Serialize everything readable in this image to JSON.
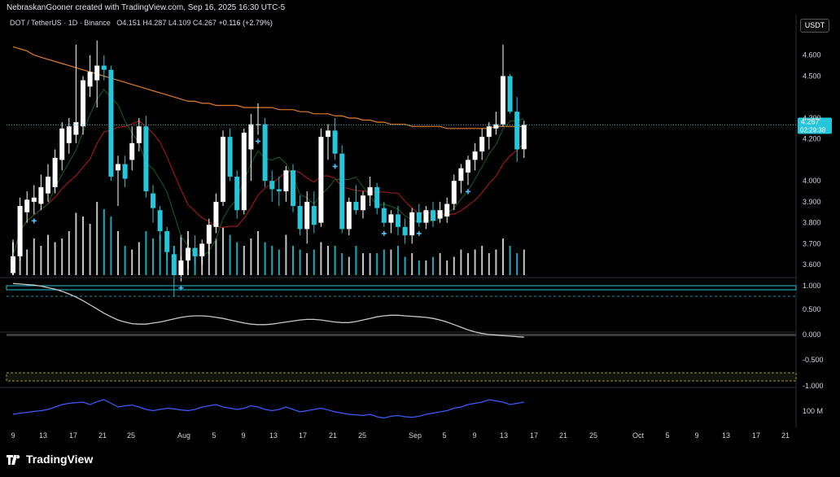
{
  "header": {
    "created_text": "NebraskanGooner created with TradingView.com, Sep 16, 2025 16:30 UTC-5",
    "symbol": "DOT / TetherUS · 1D · Binance",
    "open_label": "O",
    "open": "4.151",
    "high_label": "H",
    "high": "4.287",
    "low_label": "L",
    "low": "4.109",
    "close_label": "C",
    "close": "4.267",
    "change": "+0.116 (+2.79%)"
  },
  "currency_button": "USDT",
  "footer": {
    "brand": "TradingView"
  },
  "colors": {
    "up": "#ffffff",
    "down": "#26c6da",
    "ma_long": "#e07b2c",
    "ma_mid": "#b71c1c",
    "ma_short": "#1b5e20",
    "teal_lines": "#26c6da",
    "yellow": "#c6c43a",
    "osc": "#c8c8c8",
    "rsi": "#3d5afe",
    "price_tag": "#26c6da"
  },
  "chart_data": {
    "type": "candlestick",
    "ohlc": [
      {
        "o": 3.56,
        "h": 3.72,
        "l": 3.55,
        "c": 3.64
      },
      {
        "o": 3.64,
        "h": 3.92,
        "l": 3.62,
        "c": 3.88
      },
      {
        "o": 3.85,
        "h": 3.95,
        "l": 3.8,
        "c": 3.91
      },
      {
        "o": 3.9,
        "h": 3.98,
        "l": 3.84,
        "c": 3.92
      },
      {
        "o": 3.89,
        "h": 4.03,
        "l": 3.86,
        "c": 3.97
      },
      {
        "o": 3.94,
        "h": 4.08,
        "l": 3.9,
        "c": 4.02
      },
      {
        "o": 3.97,
        "h": 4.15,
        "l": 3.94,
        "c": 4.11
      },
      {
        "o": 4.1,
        "h": 4.28,
        "l": 4.05,
        "c": 4.25
      },
      {
        "o": 4.18,
        "h": 4.3,
        "l": 4.13,
        "c": 4.26
      },
      {
        "o": 4.22,
        "h": 4.65,
        "l": 4.18,
        "c": 4.28
      },
      {
        "o": 4.26,
        "h": 4.5,
        "l": 4.22,
        "c": 4.48
      },
      {
        "o": 4.45,
        "h": 4.6,
        "l": 4.4,
        "c": 4.52
      },
      {
        "o": 4.48,
        "h": 4.67,
        "l": 4.35,
        "c": 4.55
      },
      {
        "o": 4.55,
        "h": 4.6,
        "l": 4.48,
        "c": 4.53
      },
      {
        "o": 4.53,
        "h": 4.55,
        "l": 4.0,
        "c": 4.02
      },
      {
        "o": 4.05,
        "h": 4.12,
        "l": 3.88,
        "c": 4.08
      },
      {
        "o": 4.08,
        "h": 4.12,
        "l": 3.97,
        "c": 4.01
      },
      {
        "o": 4.1,
        "h": 4.26,
        "l": 4.05,
        "c": 4.18
      },
      {
        "o": 4.18,
        "h": 4.3,
        "l": 4.14,
        "c": 4.26
      },
      {
        "o": 4.26,
        "h": 4.31,
        "l": 3.92,
        "c": 3.95
      },
      {
        "o": 3.94,
        "h": 3.98,
        "l": 3.8,
        "c": 3.87
      },
      {
        "o": 3.86,
        "h": 3.88,
        "l": 3.72,
        "c": 3.76
      },
      {
        "o": 3.76,
        "h": 3.78,
        "l": 3.62,
        "c": 3.66
      },
      {
        "o": 3.65,
        "h": 3.69,
        "l": 3.45,
        "c": 3.55
      },
      {
        "o": 3.55,
        "h": 3.64,
        "l": 3.52,
        "c": 3.62
      },
      {
        "o": 3.62,
        "h": 3.72,
        "l": 3.58,
        "c": 3.68
      },
      {
        "o": 3.68,
        "h": 3.74,
        "l": 3.6,
        "c": 3.64
      },
      {
        "o": 3.64,
        "h": 3.72,
        "l": 3.6,
        "c": 3.7
      },
      {
        "o": 3.7,
        "h": 3.82,
        "l": 3.65,
        "c": 3.79
      },
      {
        "o": 3.78,
        "h": 3.94,
        "l": 3.75,
        "c": 3.9
      },
      {
        "o": 3.9,
        "h": 4.24,
        "l": 3.88,
        "c": 4.21
      },
      {
        "o": 4.21,
        "h": 4.25,
        "l": 4.0,
        "c": 4.02
      },
      {
        "o": 4.02,
        "h": 4.05,
        "l": 3.82,
        "c": 3.86
      },
      {
        "o": 3.86,
        "h": 4.25,
        "l": 3.84,
        "c": 4.23
      },
      {
        "o": 4.15,
        "h": 4.32,
        "l": 4.0,
        "c": 4.27
      },
      {
        "o": 4.27,
        "h": 4.37,
        "l": 4.22,
        "c": 4.27
      },
      {
        "o": 4.27,
        "h": 4.3,
        "l": 3.97,
        "c": 4.0
      },
      {
        "o": 4.0,
        "h": 4.05,
        "l": 3.9,
        "c": 3.96
      },
      {
        "o": 3.96,
        "h": 4.02,
        "l": 3.88,
        "c": 3.95
      },
      {
        "o": 3.95,
        "h": 4.07,
        "l": 3.9,
        "c": 4.05
      },
      {
        "o": 4.05,
        "h": 4.08,
        "l": 3.85,
        "c": 3.88
      },
      {
        "o": 3.88,
        "h": 3.93,
        "l": 3.74,
        "c": 3.77
      },
      {
        "o": 3.77,
        "h": 3.95,
        "l": 3.7,
        "c": 3.9
      },
      {
        "o": 3.88,
        "h": 3.95,
        "l": 3.75,
        "c": 3.79
      },
      {
        "o": 3.8,
        "h": 4.25,
        "l": 3.78,
        "c": 4.21
      },
      {
        "o": 4.21,
        "h": 4.27,
        "l": 4.1,
        "c": 4.24
      },
      {
        "o": 4.24,
        "h": 4.3,
        "l": 4.1,
        "c": 4.13
      },
      {
        "o": 4.13,
        "h": 4.17,
        "l": 3.75,
        "c": 3.77
      },
      {
        "o": 3.77,
        "h": 3.92,
        "l": 3.74,
        "c": 3.9
      },
      {
        "o": 3.9,
        "h": 3.98,
        "l": 3.84,
        "c": 3.86
      },
      {
        "o": 3.86,
        "h": 3.95,
        "l": 3.82,
        "c": 3.93
      },
      {
        "o": 3.93,
        "h": 4.02,
        "l": 3.88,
        "c": 3.97
      },
      {
        "o": 3.97,
        "h": 3.99,
        "l": 3.84,
        "c": 3.87
      },
      {
        "o": 3.87,
        "h": 3.9,
        "l": 3.78,
        "c": 3.8
      },
      {
        "o": 3.8,
        "h": 3.86,
        "l": 3.75,
        "c": 3.84
      },
      {
        "o": 3.84,
        "h": 3.88,
        "l": 3.74,
        "c": 3.78
      },
      {
        "o": 3.78,
        "h": 3.82,
        "l": 3.7,
        "c": 3.74
      },
      {
        "o": 3.74,
        "h": 3.87,
        "l": 3.7,
        "c": 3.85
      },
      {
        "o": 3.85,
        "h": 3.89,
        "l": 3.78,
        "c": 3.8
      },
      {
        "o": 3.8,
        "h": 3.88,
        "l": 3.77,
        "c": 3.86
      },
      {
        "o": 3.86,
        "h": 3.9,
        "l": 3.78,
        "c": 3.81
      },
      {
        "o": 3.82,
        "h": 3.9,
        "l": 3.8,
        "c": 3.86
      },
      {
        "o": 3.83,
        "h": 3.92,
        "l": 3.8,
        "c": 3.89
      },
      {
        "o": 3.89,
        "h": 4.03,
        "l": 3.86,
        "c": 4.0
      },
      {
        "o": 4.0,
        "h": 4.08,
        "l": 3.94,
        "c": 4.06
      },
      {
        "o": 4.04,
        "h": 4.12,
        "l": 3.98,
        "c": 4.1
      },
      {
        "o": 4.1,
        "h": 4.18,
        "l": 4.05,
        "c": 4.14
      },
      {
        "o": 4.14,
        "h": 4.25,
        "l": 4.1,
        "c": 4.21
      },
      {
        "o": 4.21,
        "h": 4.28,
        "l": 4.15,
        "c": 4.26
      },
      {
        "o": 4.25,
        "h": 4.33,
        "l": 4.22,
        "c": 4.27
      },
      {
        "o": 4.27,
        "h": 4.65,
        "l": 4.26,
        "c": 4.5
      },
      {
        "o": 4.5,
        "h": 4.51,
        "l": 4.32,
        "c": 4.33
      },
      {
        "o": 4.33,
        "h": 4.4,
        "l": 4.09,
        "c": 4.15
      },
      {
        "o": 4.151,
        "h": 4.287,
        "l": 4.109,
        "c": 4.267
      }
    ],
    "volume_relative": [
      0.45,
      0.4,
      0.35,
      0.5,
      0.4,
      0.55,
      0.45,
      0.5,
      0.6,
      0.85,
      0.8,
      0.7,
      1.0,
      0.9,
      0.8,
      0.6,
      0.4,
      0.35,
      0.45,
      0.6,
      0.5,
      0.55,
      0.45,
      0.4,
      0.55,
      0.6,
      0.35,
      0.4,
      0.45,
      0.5,
      0.65,
      0.55,
      0.45,
      0.4,
      0.5,
      0.6,
      0.45,
      0.4,
      0.35,
      0.55,
      0.4,
      0.35,
      0.3,
      0.35,
      0.45,
      0.4,
      0.4,
      0.3,
      0.25,
      0.4,
      0.3,
      0.3,
      0.3,
      0.35,
      0.35,
      0.4,
      0.25,
      0.3,
      0.2,
      0.2,
      0.25,
      0.3,
      0.2,
      0.25,
      0.35,
      0.3,
      0.35,
      0.4,
      0.3,
      0.35,
      0.5,
      0.4,
      0.3,
      0.35
    ],
    "ma_long": [
      4.64,
      4.63,
      4.62,
      4.6,
      4.59,
      4.58,
      4.57,
      4.56,
      4.55,
      4.54,
      4.53,
      4.52,
      4.51,
      4.5,
      4.49,
      4.48,
      4.47,
      4.46,
      4.45,
      4.44,
      4.43,
      4.42,
      4.41,
      4.4,
      4.39,
      4.38,
      4.38,
      4.37,
      4.37,
      4.36,
      4.36,
      4.36,
      4.36,
      4.35,
      4.35,
      4.35,
      4.35,
      4.35,
      4.34,
      4.34,
      4.34,
      4.33,
      4.33,
      4.32,
      4.32,
      4.32,
      4.31,
      4.31,
      4.3,
      4.3,
      4.29,
      4.29,
      4.28,
      4.28,
      4.27,
      4.27,
      4.27,
      4.26,
      4.26,
      4.26,
      4.26,
      4.26,
      4.25,
      4.25,
      4.25,
      4.25,
      4.25,
      4.25,
      4.25,
      4.26,
      4.26,
      4.26,
      4.26,
      4.26
    ],
    "y_axis": {
      "range": [
        3.55,
        4.7
      ],
      "ticks": [
        "4.600",
        "4.500",
        "4.300",
        "4.200",
        "4.000",
        "3.900",
        "3.800",
        "3.700",
        "3.600"
      ]
    },
    "price_tag": {
      "price": "4.267",
      "countdown": "02:29:38"
    },
    "x_axis": {
      "ticks": [
        "9",
        "13",
        "17",
        "21",
        "25",
        "Aug",
        "5",
        "9",
        "13",
        "17",
        "21",
        "25",
        "Sep",
        "5",
        "9",
        "13",
        "17",
        "21",
        "25",
        "Oct",
        "5",
        "9",
        "13",
        "17",
        "21"
      ]
    },
    "indicator1_labels": [
      "1.000",
      "0.500"
    ],
    "indicator2_labels": [
      "0.000",
      "-0.500",
      "-1.000"
    ],
    "indicator3_labels": [
      "100 M"
    ],
    "oscillator": [
      -0.98,
      -0.97,
      -0.96,
      -0.95,
      -0.93,
      -0.9,
      -0.87,
      -0.83,
      -0.78,
      -0.72,
      -0.65,
      -0.57,
      -0.49,
      -0.41,
      -0.34,
      -0.28,
      -0.24,
      -0.21,
      -0.2,
      -0.2,
      -0.22,
      -0.24,
      -0.27,
      -0.3,
      -0.33,
      -0.35,
      -0.36,
      -0.36,
      -0.35,
      -0.33,
      -0.31,
      -0.28,
      -0.25,
      -0.22,
      -0.2,
      -0.19,
      -0.19,
      -0.2,
      -0.22,
      -0.24,
      -0.26,
      -0.28,
      -0.29,
      -0.29,
      -0.28,
      -0.26,
      -0.24,
      -0.23,
      -0.23,
      -0.25,
      -0.28,
      -0.31,
      -0.34,
      -0.36,
      -0.37,
      -0.37,
      -0.36,
      -0.35,
      -0.34,
      -0.33,
      -0.31,
      -0.28,
      -0.24,
      -0.19,
      -0.14,
      -0.09,
      -0.05,
      -0.02,
      0.0,
      0.01,
      0.02,
      0.03,
      0.04,
      0.05
    ],
    "rsi_line": [
      0.3,
      0.35,
      0.38,
      0.42,
      0.45,
      0.5,
      0.6,
      0.7,
      0.75,
      0.78,
      0.8,
      0.7,
      0.82,
      0.9,
      0.75,
      0.6,
      0.65,
      0.68,
      0.6,
      0.5,
      0.45,
      0.5,
      0.55,
      0.52,
      0.48,
      0.45,
      0.5,
      0.6,
      0.65,
      0.7,
      0.6,
      0.55,
      0.5,
      0.55,
      0.65,
      0.6,
      0.5,
      0.45,
      0.5,
      0.6,
      0.5,
      0.4,
      0.45,
      0.5,
      0.55,
      0.48,
      0.4,
      0.35,
      0.3,
      0.28,
      0.25,
      0.3,
      0.2,
      0.15,
      0.22,
      0.25,
      0.2,
      0.18,
      0.22,
      0.3,
      0.35,
      0.4,
      0.45,
      0.55,
      0.6,
      0.7,
      0.75,
      0.8,
      0.9,
      0.85,
      0.8,
      0.7,
      0.75,
      0.8
    ]
  }
}
